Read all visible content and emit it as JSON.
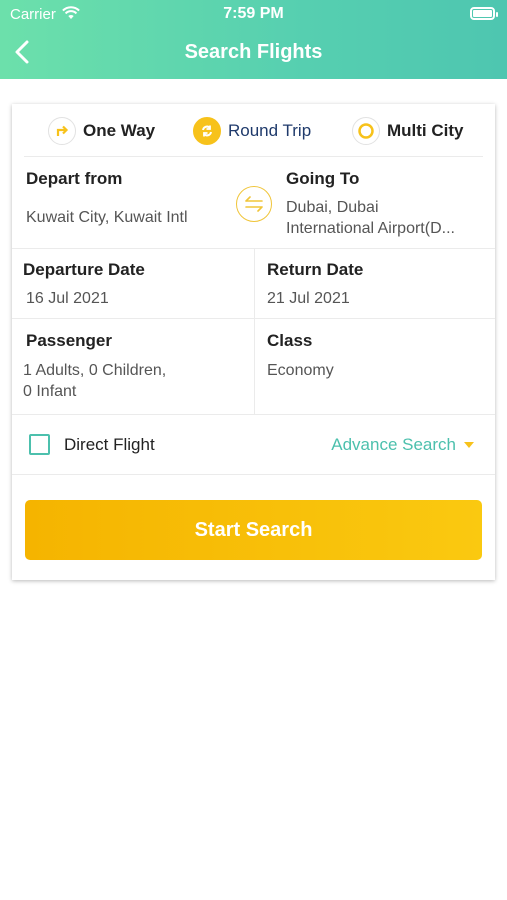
{
  "status_bar": {
    "carrier": "Carrier",
    "time": "7:59 PM"
  },
  "header": {
    "title": "Search Flights"
  },
  "trip_types": [
    {
      "label": "One Way",
      "icon": "turn-right-arrow-icon",
      "selected": false
    },
    {
      "label": "Round Trip",
      "icon": "round-trip-icon",
      "selected": true
    },
    {
      "label": "Multi City",
      "icon": "circle-icon",
      "selected": false
    }
  ],
  "depart_from": {
    "label": "Depart from",
    "value": "Kuwait City, Kuwait Intl"
  },
  "going_to": {
    "label": "Going To",
    "value_line1": "Dubai, Dubai",
    "value_line2": "International Airport(D..."
  },
  "departure_date": {
    "label": "Departure Date",
    "value": "16 Jul 2021"
  },
  "return_date": {
    "label": "Return Date",
    "value": "21 Jul 2021"
  },
  "passenger": {
    "label": "Passenger",
    "value_line1": "1 Adults, 0 Children,",
    "value_line2": "0 Infant"
  },
  "travel_class": {
    "label": "Class",
    "value": "Economy"
  },
  "direct_flight": {
    "label": "Direct Flight",
    "checked": false
  },
  "advance_search": {
    "label": "Advance Search"
  },
  "start_search": {
    "label": "Start Search"
  },
  "colors": {
    "accent_teal": "#4cc0ad",
    "accent_yellow": "#f7c21b",
    "header_start": "#6ce0ab",
    "header_end": "#4ec6b0"
  }
}
